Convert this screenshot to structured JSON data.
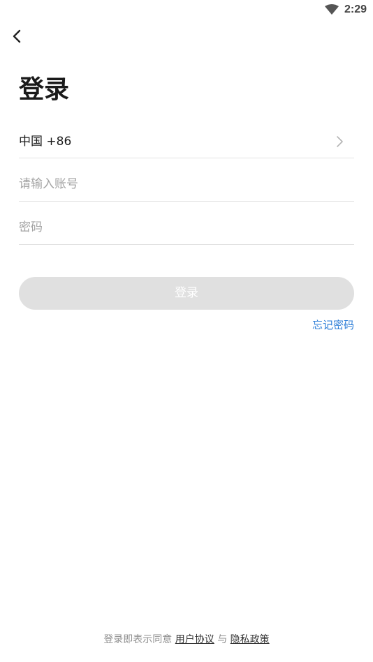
{
  "status_bar": {
    "time": "2:29",
    "wifi_icon": "wifi-icon"
  },
  "nav": {
    "back_icon": "chevron-left-icon"
  },
  "page": {
    "title": "登录"
  },
  "form": {
    "country_code": "中国 +86",
    "country_chevron_icon": "chevron-right-icon",
    "account": {
      "value": "",
      "placeholder": "请输入账号"
    },
    "password": {
      "value": "",
      "placeholder": "密码"
    },
    "login_label": "登录",
    "forgot_label": "忘记密码"
  },
  "footer": {
    "prefix": "登录即表示同意",
    "user_agreement": "用户协议",
    "connector": "与",
    "privacy_policy": "隐私政策"
  },
  "colors": {
    "accent_link": "#2f7fd8",
    "button_disabled_bg": "#e0e0e0",
    "divider": "#e2e2e2"
  }
}
